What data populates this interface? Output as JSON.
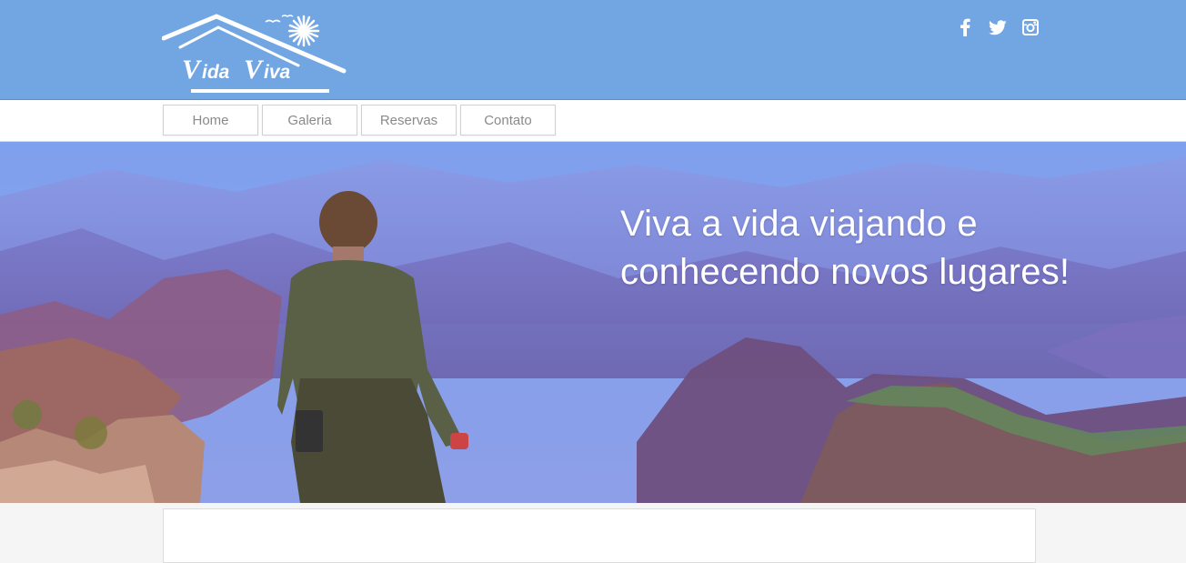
{
  "brand": {
    "logo_text": "Vida Viva"
  },
  "social": [
    {
      "icon": "facebook-icon",
      "glyph": "f"
    },
    {
      "icon": "twitter-icon",
      "glyph": "bird"
    },
    {
      "icon": "instagram-icon",
      "glyph": "camera"
    }
  ],
  "nav": {
    "items": [
      {
        "label": "Home"
      },
      {
        "label": "Galeria"
      },
      {
        "label": "Reservas"
      },
      {
        "label": "Contato"
      }
    ]
  },
  "hero": {
    "line1": "Viva a vida viajando e",
    "line2": "conhecendo novos lugares!"
  },
  "colors": {
    "header_bg": "#71a6e3",
    "nav_text": "#8a8a8a",
    "hero_text": "#ffffff"
  }
}
